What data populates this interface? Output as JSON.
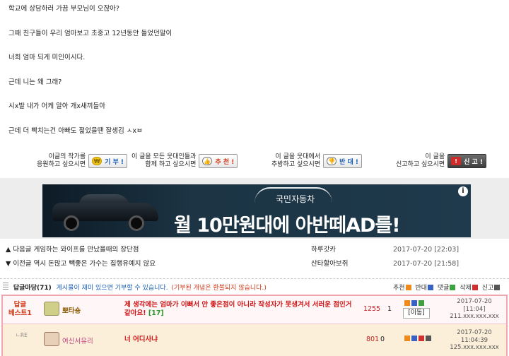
{
  "post": {
    "lines": [
      "학교에 상담하러 가끔 부모님이 오잖아?",
      "그때 친구들이 우리 엄마보고 초중고 12년동안 들었던말이",
      "너희 엄마 되게 미인이시다.",
      "근데 니는 왜 그래?",
      "시x발 내가 어케 알아 개x새끼들아",
      "근데 더 빡치는건 아빠도 젊었을땐 잘생김 ㅅxㅂ"
    ]
  },
  "actions": {
    "donate_label_1": "이글의 작가를",
    "donate_label_2": "응원하고 싶으시면",
    "donate_btn": "기 부 !",
    "recommend_label_1": "이 글을 모든 웃대인들과",
    "recommend_label_2": "함께 하고 싶으시면",
    "recommend_btn": "추 천 !",
    "oppose_label_1": "이 글을 웃대에서",
    "oppose_label_2": "추방하고 싶으시면",
    "oppose_btn": "반 대 !",
    "report_label_1": "이 글을",
    "report_label_2": "신고하고 싶으시면",
    "report_btn": "신 고 !"
  },
  "ad": {
    "brand": "국민자동차",
    "headline": "월 10만원대에 아반떼AD를!",
    "info_icon": "i"
  },
  "nav": {
    "next": {
      "label": "▲ 다음글",
      "title": "게임하는 와이프를 만났을때의 장단점",
      "author": "하루갓카",
      "date": "2017-07-20 [22:03]"
    },
    "prev": {
      "label": "▼ 이전글",
      "title": "역시 돈많고 빽좋은 가수는 집행유예지 않요",
      "author": "산타할아보쥐",
      "date": "2017-07-20 [21:58]"
    }
  },
  "comments_bar": {
    "title": "답글마당(71)",
    "note1": "게시물이 재미 있으면 기부할 수 있습니다.",
    "note2": "(기부된 개념은 환불되지 않습니다.)",
    "legend_recommend": "추천",
    "legend_oppose": "반대",
    "legend_reply": "댓글",
    "legend_delete": "삭제",
    "legend_report": "신고"
  },
  "comments": [
    {
      "tag_1": "답글",
      "tag_2": "베스트1",
      "nick": "뽀타숑",
      "text": "제 생각에는 엄마가 이뻐서 안 좋은점이 아니라 작성자가 못생겨서 서러운 점인거 같아요!",
      "count": "[17]",
      "score": "1255",
      "score2": "1",
      "move": "[이동]",
      "date": "2017-07-20",
      "time": "[11:04]",
      "ip": "211.xxx.xxx.xxx"
    },
    {
      "re": "ㄴRE",
      "nick": "여신서유리",
      "text": "너 어디사냐",
      "score": "801",
      "score2": "0",
      "date": "2017-07-20",
      "time": "11:04:39",
      "ip": "125.xxx.xxx.xxx"
    }
  ]
}
